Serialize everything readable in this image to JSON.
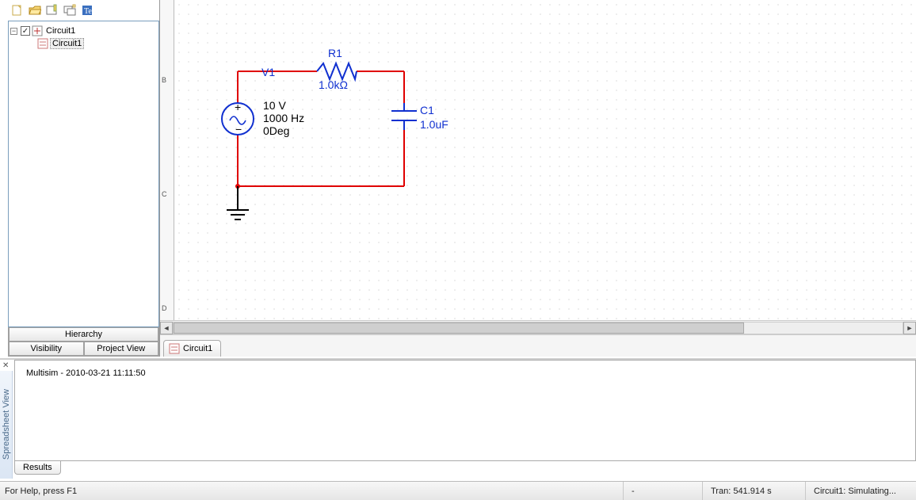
{
  "sidebar": {
    "root": {
      "label": "Circuit1",
      "expanded": true,
      "checked": true
    },
    "child": {
      "label": "Circuit1",
      "selected": true
    },
    "tabs": {
      "hierarchy": "Hierarchy",
      "visibility": "Visibility",
      "project_view": "Project View"
    }
  },
  "canvas": {
    "ruler_marks": [
      "B",
      "C",
      "D"
    ],
    "doc_tab": "Circuit1"
  },
  "circuit": {
    "v1": {
      "ref": "V1",
      "lines": [
        "10 V",
        "1000 Hz",
        "0Deg"
      ]
    },
    "r1": {
      "ref": "R1",
      "value": "1.0kΩ"
    },
    "c1": {
      "ref": "C1",
      "value": "1.0uF"
    }
  },
  "spreadsheet": {
    "label": "Spreadsheet View",
    "content_app": "Multisim",
    "content_sep": "  -  ",
    "content_ts": "2010-03-21 11:11:50",
    "tab": "Results"
  },
  "statusbar": {
    "help": "For Help, press F1",
    "mid": "-",
    "tran": "Tran: 541.914 s",
    "sim": "Circuit1: Simulating..."
  }
}
